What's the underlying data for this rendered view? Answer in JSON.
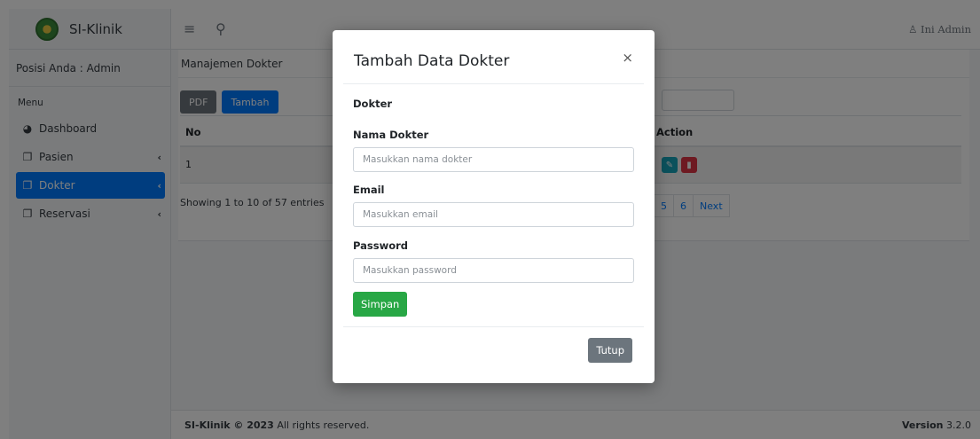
{
  "app": {
    "brand": "SI-Klinik"
  },
  "sidebar": {
    "position_text": "Posisi Anda : Admin",
    "menu_header": "Menu",
    "items": [
      {
        "label": "Dashboard",
        "icon": "chart-pie-icon",
        "active": false,
        "has_children": false
      },
      {
        "label": "Pasien",
        "icon": "copy-icon",
        "active": false,
        "has_children": true
      },
      {
        "label": "Dokter",
        "icon": "copy-icon",
        "active": true,
        "has_children": true
      },
      {
        "label": "Reservasi",
        "icon": "copy-icon",
        "active": false,
        "has_children": true
      }
    ]
  },
  "topbar": {
    "menu_icon": "≡",
    "search_icon": "⚲",
    "user_label": "Ini Admin"
  },
  "page": {
    "card_title": "Manajemen Dokter",
    "pdf_button": "PDF",
    "add_button": "Tambah",
    "table": {
      "headers": [
        "No",
        "Action"
      ],
      "rows": [
        {
          "no": "1"
        }
      ]
    },
    "showing": "Showing 1 to 10 of 57 entries",
    "pagination": [
      "5",
      "6",
      "Next"
    ]
  },
  "footer": {
    "brand": "SI-Klinik © 2023",
    "rights": "All rights reserved.",
    "version_label": "Version",
    "version_number": "3.2.0"
  },
  "modal": {
    "title": "Tambah Data Dokter",
    "close": "×",
    "section": "Dokter",
    "fields": [
      {
        "label": "Nama Dokter",
        "placeholder": "Masukkan nama dokter",
        "value": ""
      },
      {
        "label": "Email",
        "placeholder": "Masukkan email",
        "value": ""
      },
      {
        "label": "Password",
        "placeholder": "Masukkan password",
        "value": ""
      }
    ],
    "submit_button": "Simpan",
    "close_button": "Tutup"
  },
  "colors": {
    "primary": "#007bff",
    "success": "#28a745",
    "secondary": "#6c757d",
    "info": "#17a2b8",
    "danger": "#dc3545"
  }
}
